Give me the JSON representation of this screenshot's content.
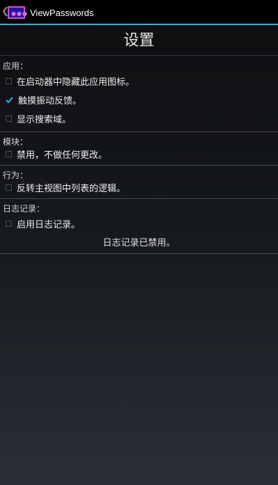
{
  "app": {
    "title": "ViewPasswords"
  },
  "page": {
    "title": "设置"
  },
  "sections": [
    {
      "header": "应用：",
      "items": [
        {
          "label": "在启动器中隐藏此应用图标。",
          "checked": false
        },
        {
          "label": "触摸振动反馈。",
          "checked": true
        },
        {
          "label": "显示搜索域。",
          "checked": false
        }
      ]
    },
    {
      "header": "模块：",
      "items": [
        {
          "label": "禁用，不做任何更改。",
          "checked": false
        }
      ]
    },
    {
      "header": "行为：",
      "items": [
        {
          "label": "反转主视图中列表的逻辑。",
          "checked": false
        }
      ]
    },
    {
      "header": "日志记录：",
      "items": [
        {
          "label": "启用日志记录。",
          "checked": false
        }
      ],
      "status": "日志记录已禁用。"
    }
  ],
  "colors": {
    "accent": "#33b5e5"
  },
  "icons": {
    "back": "chevron-left-icon",
    "app": "app-icon",
    "check": "checkmark-icon"
  }
}
